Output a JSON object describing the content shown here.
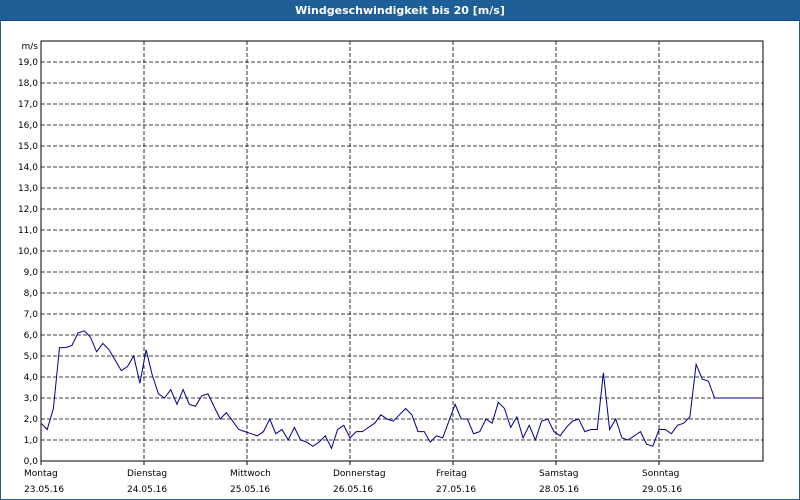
{
  "window": {
    "title": "Windgeschwindigkeit bis 20 [m/s]"
  },
  "chart_data": {
    "type": "line",
    "title": "Windgeschwindigkeit bis 20 [m/s]",
    "ylabel": "m/s",
    "xlabel": "",
    "ylim": [
      0,
      20
    ],
    "xlim_days": [
      0,
      7
    ],
    "grid": true,
    "y_ticks": [
      "0,0",
      "1,0",
      "2,0",
      "3,0",
      "4,0",
      "5,0",
      "6,0",
      "7,0",
      "8,0",
      "9,0",
      "10,0",
      "11,0",
      "12,0",
      "13,0",
      "14,0",
      "15,0",
      "16,0",
      "17,0",
      "18,0",
      "19,0"
    ],
    "x_ticks": [
      {
        "day": "Montag",
        "date": "23.05.16"
      },
      {
        "day": "Dienstag",
        "date": "24.05.16"
      },
      {
        "day": "Mittwoch",
        "date": "25.05.16"
      },
      {
        "day": "Donnerstag",
        "date": "26.05.16"
      },
      {
        "day": "Freitag",
        "date": "27.05.16"
      },
      {
        "day": "Samstag",
        "date": "28.05.16"
      },
      {
        "day": "Sonntag",
        "date": "29.05.16"
      }
    ],
    "series": [
      {
        "color": "#00008b",
        "x": [
          0,
          0.06,
          0.12,
          0.18,
          0.24,
          0.3,
          0.36,
          0.42,
          0.48,
          0.54,
          0.6,
          0.66,
          0.72,
          0.78,
          0.84,
          0.9,
          0.96,
          1.02,
          1.08,
          1.14,
          1.2,
          1.26,
          1.32,
          1.38,
          1.44,
          1.5,
          1.56,
          1.62,
          1.68,
          1.74,
          1.8,
          1.86,
          1.92,
          1.98,
          2.04,
          2.1,
          2.16,
          2.22,
          2.28,
          2.34,
          2.4,
          2.46,
          2.52,
          2.58,
          2.64,
          2.7,
          2.76,
          2.82,
          2.88,
          2.94,
          3.0,
          3.06,
          3.12,
          3.18,
          3.24,
          3.3,
          3.36,
          3.42,
          3.48,
          3.54,
          3.6,
          3.66,
          3.72,
          3.78,
          3.84,
          3.9,
          3.96,
          4.02,
          4.08,
          4.14,
          4.2,
          4.26,
          4.32,
          4.38,
          4.44,
          4.5,
          4.56,
          4.62,
          4.68,
          4.74,
          4.8,
          4.86,
          4.92,
          4.98,
          5.04,
          5.1,
          5.16,
          5.22,
          5.28,
          5.34,
          5.4,
          5.46,
          5.52,
          5.58,
          5.64,
          5.7,
          5.76,
          5.82,
          5.88,
          5.94,
          6.0,
          6.06,
          6.12,
          6.18,
          6.24,
          6.3,
          6.36,
          6.42,
          6.48,
          6.54,
          6.6,
          6.66,
          6.72,
          6.78,
          6.84,
          6.9,
          6.96,
          7.0
        ],
        "values": [
          1.8,
          1.5,
          2.5,
          5.4,
          5.4,
          5.5,
          6.1,
          6.2,
          5.9,
          5.2,
          5.6,
          5.3,
          4.8,
          4.3,
          4.5,
          5.0,
          3.7,
          5.3,
          4.1,
          3.2,
          3.0,
          3.4,
          2.7,
          3.4,
          2.7,
          2.6,
          3.1,
          3.2,
          2.6,
          2.0,
          2.3,
          1.9,
          1.5,
          1.4,
          1.3,
          1.2,
          1.4,
          2.0,
          1.3,
          1.5,
          1.0,
          1.6,
          1.0,
          0.9,
          0.7,
          0.9,
          1.2,
          0.6,
          1.5,
          1.7,
          1.1,
          1.4,
          1.4,
          1.6,
          1.8,
          2.2,
          2.0,
          1.9,
          2.2,
          2.5,
          2.2,
          1.4,
          1.4,
          0.9,
          1.2,
          1.1,
          1.9,
          2.7,
          2.0,
          2.0,
          1.3,
          1.4,
          2.0,
          1.8,
          2.8,
          2.5,
          1.6,
          2.1,
          1.1,
          1.7,
          1.0,
          1.9,
          2.0,
          1.4,
          1.2,
          1.6,
          1.9,
          2.0,
          1.4,
          1.5,
          1.5,
          4.2,
          1.5,
          2.0,
          1.1,
          1.0,
          1.2,
          1.4,
          0.8,
          0.7,
          1.5,
          1.5,
          1.3,
          1.7,
          1.8,
          2.1,
          4.6,
          3.9,
          3.8,
          3.0,
          3.0,
          3.0,
          3.0,
          3.0,
          3.0,
          3.0,
          3.0,
          3.0
        ]
      }
    ]
  }
}
